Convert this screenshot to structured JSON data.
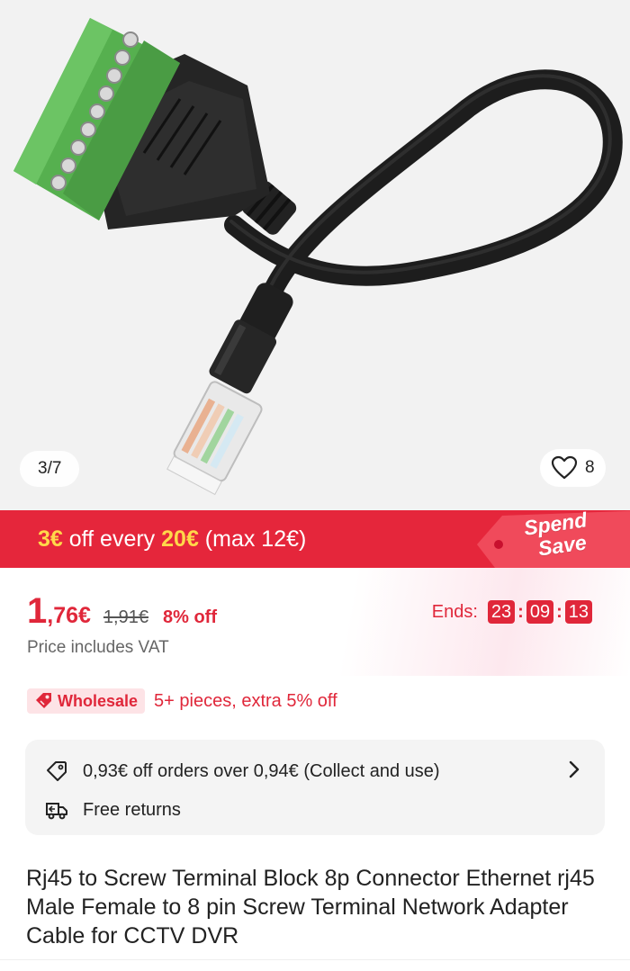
{
  "gallery": {
    "counter": "3/7",
    "favorites_count": "8"
  },
  "promo": {
    "amount": "3€",
    "middle": " off every ",
    "threshold": "20€",
    "suffix": " (max 12€)",
    "tag_line1": "Spend",
    "tag_line2": "Save"
  },
  "price": {
    "integer": "1",
    "fraction": ",76€",
    "original": "1,91€",
    "discount": "8% off",
    "vat_note": "Price includes VAT",
    "ends_label": "Ends:",
    "hours": "23",
    "minutes": "09",
    "seconds": "13"
  },
  "wholesale": {
    "badge": "Wholesale",
    "text": "5+ pieces, extra 5% off"
  },
  "offers": {
    "coupon": "0,93€ off orders over 0,94€ (Collect and use)",
    "returns": "Free returns"
  },
  "product": {
    "title": "Rj45 to Screw Terminal Block 8p Connector Ethernet rj45 Male Female to 8 pin Screw Terminal Network Adapter Cable for CCTV DVR"
  },
  "colors": {
    "brand_red": "#e0273a",
    "banner_red": "#e5263b",
    "highlight_yellow": "#ffd84a",
    "terminal_green": "#5cb85c"
  }
}
